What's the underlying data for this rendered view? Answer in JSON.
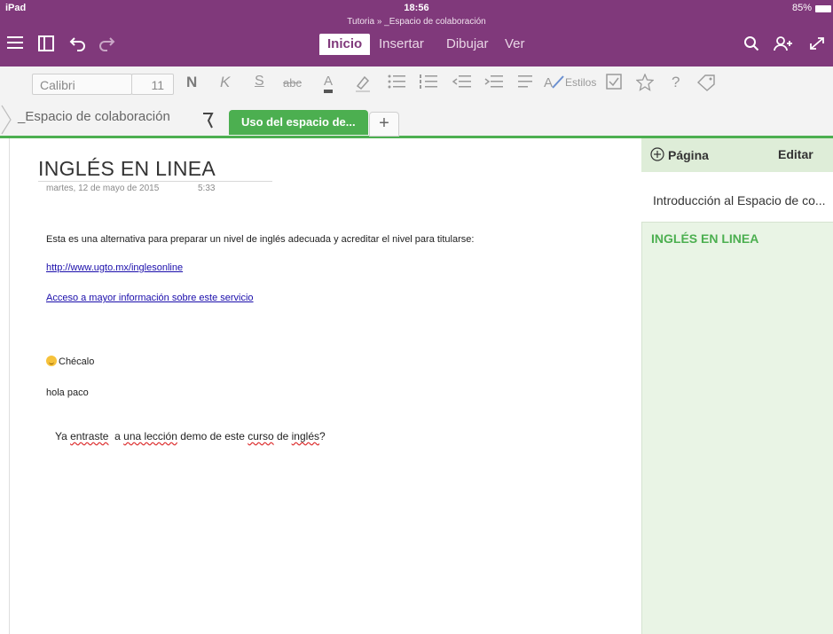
{
  "status_bar": {
    "device": "iPad",
    "time": "18:56",
    "battery": "85%"
  },
  "document_title": "Tutoria » _Espacio de colaboración",
  "ribbon_tabs": [
    {
      "label": "Inicio"
    },
    {
      "label": "Insertar"
    },
    {
      "label": "Dibujar"
    },
    {
      "label": "Ver"
    }
  ],
  "toolbar": {
    "menu_icon": "hamburger-icon",
    "notebook_icon": "notebook-icon",
    "undo_icon": "undo-icon",
    "redo_icon": "redo-icon",
    "search_icon": "search-icon",
    "share_icon": "add-person-icon",
    "fullscreen_icon": "expand-icon"
  },
  "format_bar": {
    "font_name": "Calibri",
    "font_size": "11",
    "bold": "N",
    "italic": "K",
    "underline": "S",
    "strike": "abc",
    "font_color": "A",
    "styles_label": "Estilos",
    "question": "?"
  },
  "section_bar": {
    "section_name": "_Espacio de colaboración",
    "active_tab": "Uso del espacio de...",
    "add_label": "+"
  },
  "page": {
    "title": "INGLÉS EN LINEA",
    "date": "martes, 12 de mayo  de 2015",
    "time": "5:33",
    "paragraph": "Esta es una alternativa para preparar un nivel de inglés adecuada y acreditar el nivel para titularse:",
    "link1": "http://www.ugto.mx/inglesonline",
    "link2": "Acceso a mayor información sobre este servicio",
    "checalo": "Chécalo",
    "hola": "hola paco",
    "question_parts": [
      "Ya ",
      "entraste",
      "  a ",
      "una lección",
      " demo de este ",
      "curso",
      " de ",
      "inglés",
      "?"
    ]
  },
  "pages_panel": {
    "add_page_label": "Página",
    "edit_label": "Editar",
    "items": [
      {
        "label": "Introducción al Espacio de co..."
      },
      {
        "label": "INGLÉS EN LINEA"
      }
    ]
  },
  "colors": {
    "purple": "#80397b",
    "green": "#4caf50",
    "panel_bg": "#e9f4e5"
  }
}
